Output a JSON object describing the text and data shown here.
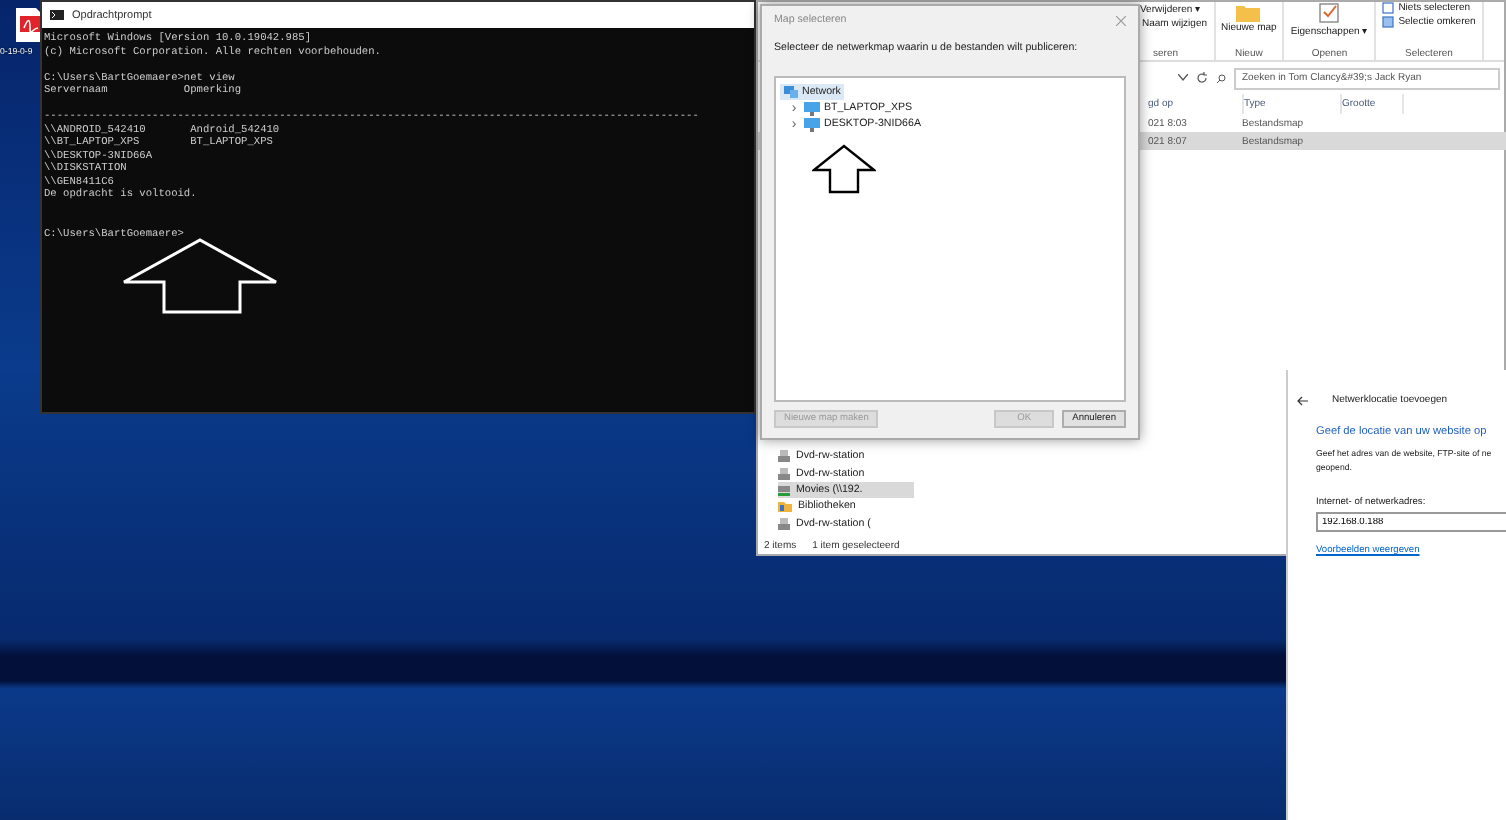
{
  "desktop_icon": {
    "label": "0-19-0-9"
  },
  "cmd": {
    "title": "Opdrachtprompt",
    "blocks": [
      [
        "Microsoft Windows [Version 10.0.19042.985]",
        "(c) Microsoft Corporation. Alle rechten voorbehouden."
      ],
      [
        "C:\\Users\\BartGoemaere>net view",
        "Servernaam            Opmerking"
      ],
      [
        "-------------------------------------------------------------------------------------------------------",
        "\\\\ANDROID_542410       Android_542410",
        "\\\\BT_LAPTOP_XPS        BT_LAPTOP_XPS",
        "\\\\DESKTOP-3NID66A",
        "\\\\DISKSTATION",
        "\\\\GEN8411C6",
        "De opdracht is voltooid."
      ],
      [
        "C:\\Users\\BartGoemaere>"
      ]
    ]
  },
  "explorer": {
    "ribbon_groups": [
      {
        "label": "seren",
        "items": [
          {
            "label": "Verwijderen ▾",
            "kind": "delete"
          },
          {
            "label": "Naam wijzigen",
            "kind": "rename"
          }
        ]
      },
      {
        "label": "Nieuw",
        "items": [
          {
            "label": "Nieuwe map",
            "kind": "folder"
          }
        ]
      },
      {
        "label": "Openen",
        "items": [
          {
            "label": "Eigenschappen ▾",
            "kind": "properties"
          }
        ]
      },
      {
        "label": "Selecteren",
        "items": [
          {
            "label": "Niets selecteren",
            "kind": "select"
          },
          {
            "label": "Selectie omkeren",
            "kind": "invert"
          }
        ]
      }
    ],
    "search": {
      "placeholder": "Zoeken in Tom Clancy&#39;s Jack Ryan"
    },
    "columns": [
      "gd op",
      "Type",
      "Grootte"
    ],
    "rows": [
      {
        "modified": "021 8:03",
        "type": "Bestandsmap",
        "selected": false
      },
      {
        "modified": "021 8:07",
        "type": "Bestandsmap",
        "selected": true
      }
    ],
    "nav_items": [
      {
        "label": "Dvd-rw-station",
        "kind": "drive",
        "selected": false
      },
      {
        "label": "Dvd-rw-station",
        "kind": "drive",
        "selected": false
      },
      {
        "label": "Movies (\\\\192.",
        "kind": "network",
        "selected": true
      },
      {
        "label": "Bibliotheken",
        "kind": "library",
        "selected": false
      },
      {
        "label": "Dvd-rw-station (",
        "kind": "drive",
        "selected": false
      }
    ],
    "status": [
      "2 items",
      "1 item geselecteerd"
    ]
  },
  "dialog": {
    "title": "Map selecteren",
    "instruction": "Selecteer de netwerkmap waarin u de bestanden wilt publiceren:",
    "tree": [
      {
        "label": "Network",
        "selected": true,
        "children": [
          {
            "label": "BT_LAPTOP_XPS",
            "selected": false,
            "expander": "›"
          },
          {
            "label": "DESKTOP-3NID66A",
            "selected": false,
            "expander": "›"
          }
        ]
      }
    ],
    "buttons": [
      {
        "label": "Nieuwe map maken",
        "disabled": true
      },
      {
        "label": "OK",
        "disabled": true
      },
      {
        "label": "Annuleren",
        "disabled": false
      }
    ]
  },
  "wizard": {
    "title": "Netwerklocatie toevoegen",
    "heading": "Geef de locatie van uw website op",
    "description": "Geef het adres van de website, FTP-site of ne\ngeopend.",
    "field_label": "Internet- of netwerkadres:",
    "field_value": "192.168.0.188",
    "link": "Voorbeelden weergeven"
  }
}
